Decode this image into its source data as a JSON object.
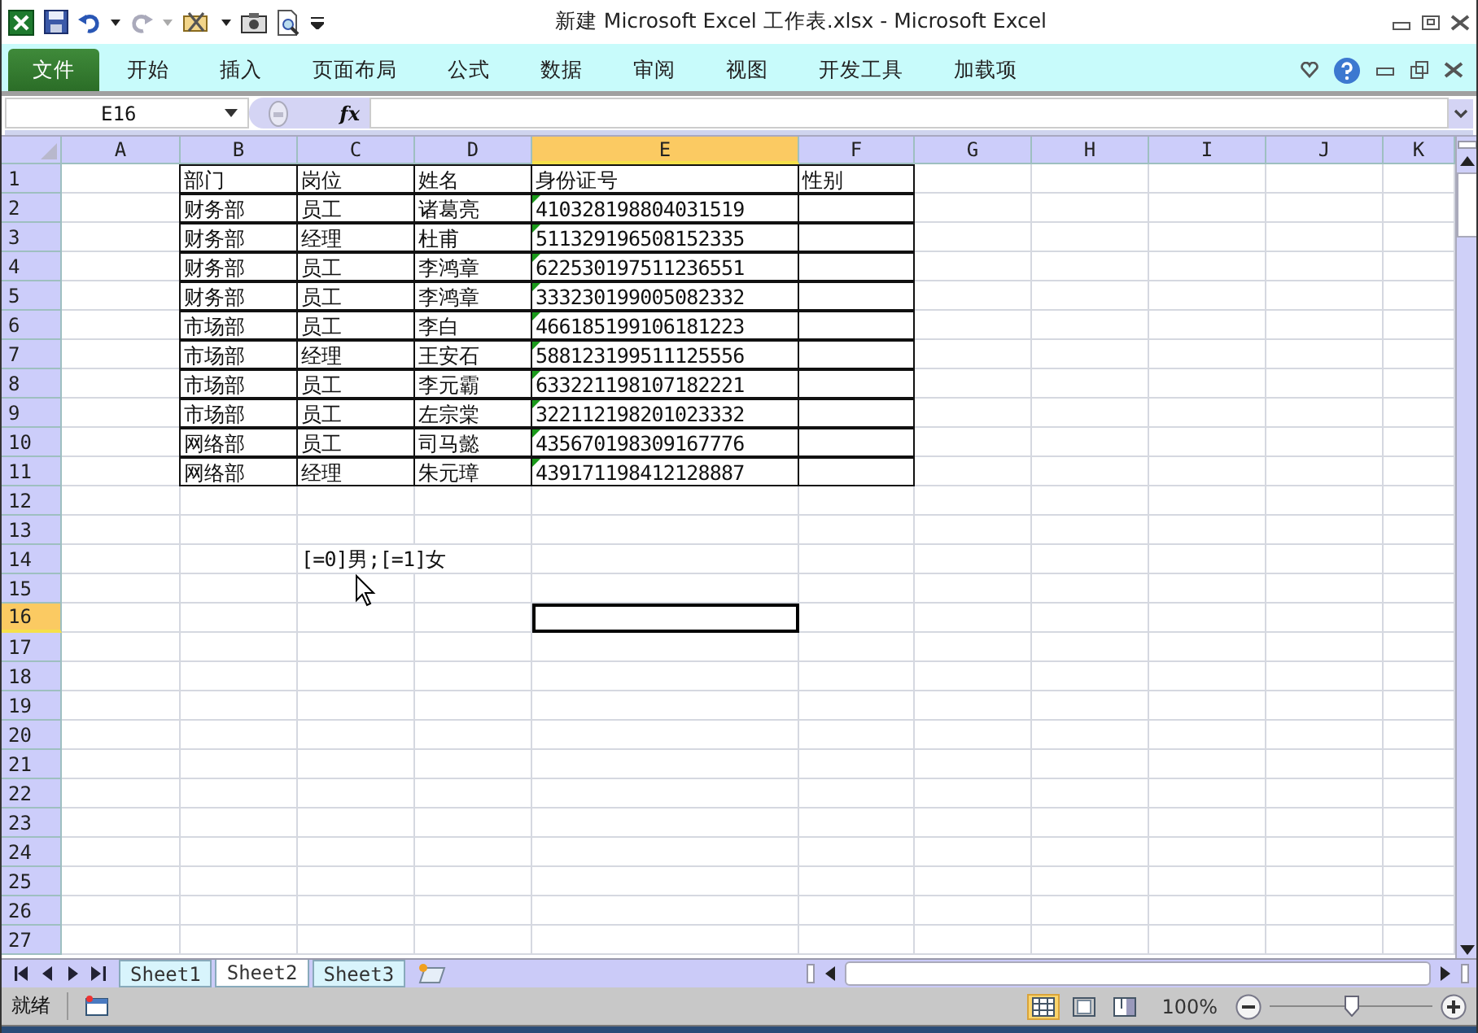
{
  "window": {
    "title": "新建 Microsoft Excel 工作表.xlsx  -  Microsoft Excel"
  },
  "ribbon_tabs": [
    {
      "label": "文件",
      "kind": "file",
      "selected": false
    },
    {
      "label": "开始",
      "kind": "tab",
      "selected": false
    },
    {
      "label": "插入",
      "kind": "tab",
      "selected": false
    },
    {
      "label": "页面布局",
      "kind": "tab",
      "selected": false
    },
    {
      "label": "公式",
      "kind": "tab",
      "selected": false
    },
    {
      "label": "数据",
      "kind": "tab",
      "selected": false
    },
    {
      "label": "审阅",
      "kind": "tab",
      "selected": false
    },
    {
      "label": "视图",
      "kind": "tab",
      "selected": false
    },
    {
      "label": "开发工具",
      "kind": "tab",
      "selected": false
    },
    {
      "label": "加载项",
      "kind": "tab",
      "selected": false
    }
  ],
  "formula_bar": {
    "name_box": "E16",
    "fx_label": "fx"
  },
  "sheet": {
    "columns": [
      {
        "label": "A",
        "selected": false
      },
      {
        "label": "B",
        "selected": false
      },
      {
        "label": "C",
        "selected": false
      },
      {
        "label": "D",
        "selected": false
      },
      {
        "label": "E",
        "selected": true
      },
      {
        "label": "F",
        "selected": false
      },
      {
        "label": "G",
        "selected": false
      },
      {
        "label": "H",
        "selected": false
      },
      {
        "label": "I",
        "selected": false
      },
      {
        "label": "J",
        "selected": false
      },
      {
        "label": "K",
        "selected": false
      }
    ],
    "rows": [
      {
        "label": "1",
        "selected": false,
        "bordered": true,
        "error_flag": false,
        "cells": [
          "",
          "部门",
          "岗位",
          "姓名",
          "身份证号",
          "性别"
        ]
      },
      {
        "label": "2",
        "selected": false,
        "bordered": true,
        "error_flag": true,
        "cells": [
          "",
          "财务部",
          "员工",
          "诸葛亮",
          "410328198804031519",
          ""
        ]
      },
      {
        "label": "3",
        "selected": false,
        "bordered": true,
        "error_flag": true,
        "cells": [
          "",
          "财务部",
          "经理",
          "杜甫",
          "511329196508152335",
          ""
        ]
      },
      {
        "label": "4",
        "selected": false,
        "bordered": true,
        "error_flag": true,
        "cells": [
          "",
          "财务部",
          "员工",
          "李鸿章",
          "622530197511236551",
          ""
        ]
      },
      {
        "label": "5",
        "selected": false,
        "bordered": true,
        "error_flag": true,
        "cells": [
          "",
          "财务部",
          "员工",
          "李鸿章",
          "333230199005082332",
          ""
        ]
      },
      {
        "label": "6",
        "selected": false,
        "bordered": true,
        "error_flag": true,
        "cells": [
          "",
          "市场部",
          "员工",
          "李白",
          "466185199106181223",
          ""
        ]
      },
      {
        "label": "7",
        "selected": false,
        "bordered": true,
        "error_flag": true,
        "cells": [
          "",
          "市场部",
          "经理",
          "王安石",
          "588123199511125556",
          ""
        ]
      },
      {
        "label": "8",
        "selected": false,
        "bordered": true,
        "error_flag": true,
        "cells": [
          "",
          "市场部",
          "员工",
          "李元霸",
          "633221198107182221",
          ""
        ]
      },
      {
        "label": "9",
        "selected": false,
        "bordered": true,
        "error_flag": true,
        "cells": [
          "",
          "市场部",
          "员工",
          "左宗棠",
          "322112198201023332",
          ""
        ]
      },
      {
        "label": "10",
        "selected": false,
        "bordered": true,
        "error_flag": true,
        "cells": [
          "",
          "网络部",
          "员工",
          "司马懿",
          "435670198309167776",
          ""
        ]
      },
      {
        "label": "11",
        "selected": false,
        "bordered": true,
        "error_flag": true,
        "cells": [
          "",
          "网络部",
          "经理",
          "朱元璋",
          "439171198412128887",
          ""
        ]
      },
      {
        "label": "12",
        "selected": false,
        "bordered": false,
        "error_flag": false,
        "cells": []
      },
      {
        "label": "13",
        "selected": false,
        "bordered": false,
        "error_flag": false,
        "cells": []
      },
      {
        "label": "14",
        "selected": false,
        "bordered": false,
        "error_flag": false,
        "cells": [
          "",
          "",
          "[=0]男;[=1]女"
        ]
      },
      {
        "label": "15",
        "selected": false,
        "bordered": false,
        "error_flag": false,
        "cells": []
      },
      {
        "label": "16",
        "selected": true,
        "bordered": false,
        "error_flag": false,
        "cells": []
      },
      {
        "label": "17",
        "selected": false,
        "bordered": false,
        "error_flag": false,
        "cells": []
      },
      {
        "label": "18",
        "selected": false,
        "bordered": false,
        "error_flag": false,
        "cells": []
      },
      {
        "label": "19",
        "selected": false,
        "bordered": false,
        "error_flag": false,
        "cells": []
      },
      {
        "label": "20",
        "selected": false,
        "bordered": false,
        "error_flag": false,
        "cells": []
      },
      {
        "label": "21",
        "selected": false,
        "bordered": false,
        "error_flag": false,
        "cells": []
      },
      {
        "label": "22",
        "selected": false,
        "bordered": false,
        "error_flag": false,
        "cells": []
      },
      {
        "label": "23",
        "selected": false,
        "bordered": false,
        "error_flag": false,
        "cells": []
      },
      {
        "label": "24",
        "selected": false,
        "bordered": false,
        "error_flag": false,
        "cells": []
      },
      {
        "label": "25",
        "selected": false,
        "bordered": false,
        "error_flag": false,
        "cells": []
      },
      {
        "label": "26",
        "selected": false,
        "bordered": false,
        "error_flag": false,
        "cells": []
      },
      {
        "label": "27",
        "selected": false,
        "bordered": false,
        "error_flag": false,
        "cells": []
      }
    ]
  },
  "sheet_tabs": [
    {
      "label": "Sheet1",
      "selected": false
    },
    {
      "label": "Sheet2",
      "selected": true
    },
    {
      "label": "Sheet3",
      "selected": false
    }
  ],
  "status_bar": {
    "status": "就绪",
    "zoom": "100%",
    "zoom_slider": {
      "level": 0.5
    }
  }
}
